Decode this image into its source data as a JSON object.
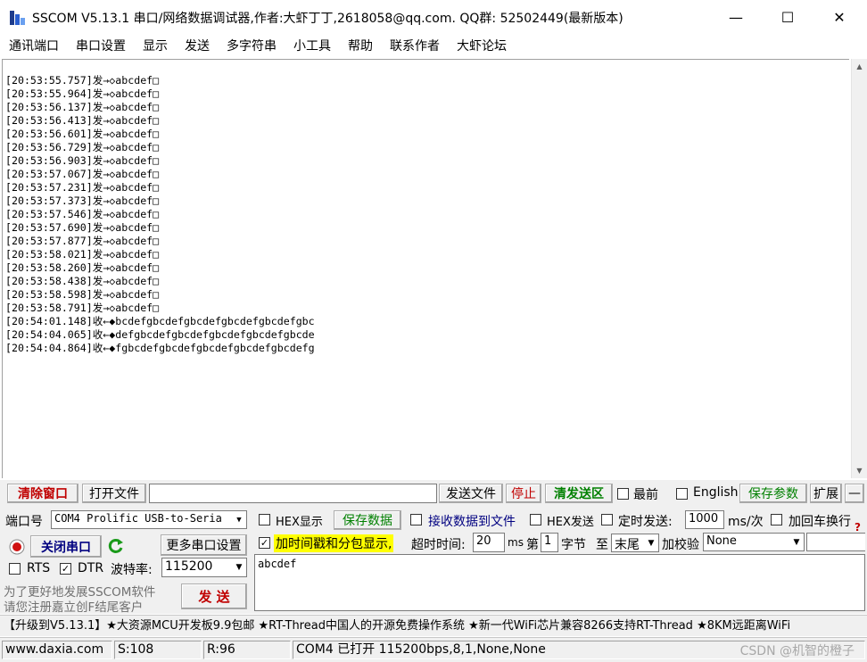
{
  "window": {
    "title": "SSCOM V5.13.1 串口/网络数据调试器,作者:大虾丁丁,2618058@qq.com. QQ群: 52502449(最新版本)",
    "minimize": "—",
    "maximize": "☐",
    "close": "✕"
  },
  "menu": [
    "通讯端口",
    "串口设置",
    "显示",
    "发送",
    "多字符串",
    "小工具",
    "帮助",
    "联系作者",
    "大虾论坛"
  ],
  "receive": {
    "lines": [
      "[20:53:55.757]发→◇abcdef□",
      "[20:53:55.964]发→◇abcdef□",
      "[20:53:56.137]发→◇abcdef□",
      "[20:53:56.413]发→◇abcdef□",
      "[20:53:56.601]发→◇abcdef□",
      "[20:53:56.729]发→◇abcdef□",
      "[20:53:56.903]发→◇abcdef□",
      "[20:53:57.067]发→◇abcdef□",
      "[20:53:57.231]发→◇abcdef□",
      "[20:53:57.373]发→◇abcdef□",
      "[20:53:57.546]发→◇abcdef□",
      "[20:53:57.690]发→◇abcdef□",
      "[20:53:57.877]发→◇abcdef□",
      "[20:53:58.021]发→◇abcdef□",
      "[20:53:58.260]发→◇abcdef□",
      "[20:53:58.438]发→◇abcdef□",
      "[20:53:58.598]发→◇abcdef□",
      "[20:53:58.791]发→◇abcdef□",
      "[20:54:01.148]收←◆bcdefgbcdefgbcdefgbcdefgbcdefgbc",
      "[20:54:04.065]收←◆defgbcdefgbcdefgbcdefgbcdefgbcde",
      "[20:54:04.864]收←◆fgbcdefgbcdefgbcdefgbcdefgbcdefg"
    ]
  },
  "toolbar": {
    "clear_window": "清除窗口",
    "open_file": "打开文件",
    "file_path": "",
    "send_file": "发送文件",
    "stop": "停止",
    "clear_send": "清发送区",
    "last_label": "最前",
    "english_label": "English",
    "save_params": "保存参数",
    "expand": "扩展",
    "collapse": "—"
  },
  "port": {
    "label": "端口号",
    "value": "COM4 Prolific USB-to-Seria",
    "close_port": "关闭串口",
    "more_settings": "更多串口设置",
    "rts_label": "RTS",
    "dtr_label": "DTR",
    "baud_label": "波特率:",
    "baud_value": "115200"
  },
  "options": {
    "hex_display": "HEX显示",
    "save_data": "保存数据",
    "recv_to_file": "接收数据到文件",
    "hex_send": "HEX发送",
    "timed_send": "定时发送:",
    "interval_value": "1000",
    "interval_unit": "ms/次",
    "add_crlf": "加回车换行",
    "add_timestamp": "加时间戳和分包显示,",
    "timeout_label": "超时时间:",
    "timeout_value": "20",
    "timeout_unit": "ms",
    "byte_prefix": "第",
    "byte_index": "1",
    "byte_label": "字节",
    "to_label": "至",
    "end_value": "末尾",
    "checksum_label": "加校验",
    "checksum_value": "None",
    "help_mark": "?"
  },
  "send": {
    "text": "abcdef",
    "button": "发  送",
    "promo_line1": "为了更好地发展SSCOM软件",
    "promo_line2": "请您注册嘉立创F结尾客户"
  },
  "ticker": "【升级到V5.13.1】★大资源MCU开发板9.9包邮 ★RT-Thread中国人的开源免费操作系统 ★新一代WiFi芯片兼容8266支持RT-Thread ★8KM远距离WiFi",
  "status": {
    "website": "www.daxia.com",
    "sent": "S:108",
    "received": "R:96",
    "port_status": "COM4 已打开  115200bps,8,1,None,None",
    "watermark": "CSDN @机智的橙子"
  },
  "colors": {
    "clear_window": "#c00000",
    "stop": "#c00000",
    "clear_send": "#008000",
    "save_params": "#008000",
    "close_port": "#000080",
    "send_button": "#c00000",
    "timestamp_highlight": "#ffff00"
  }
}
